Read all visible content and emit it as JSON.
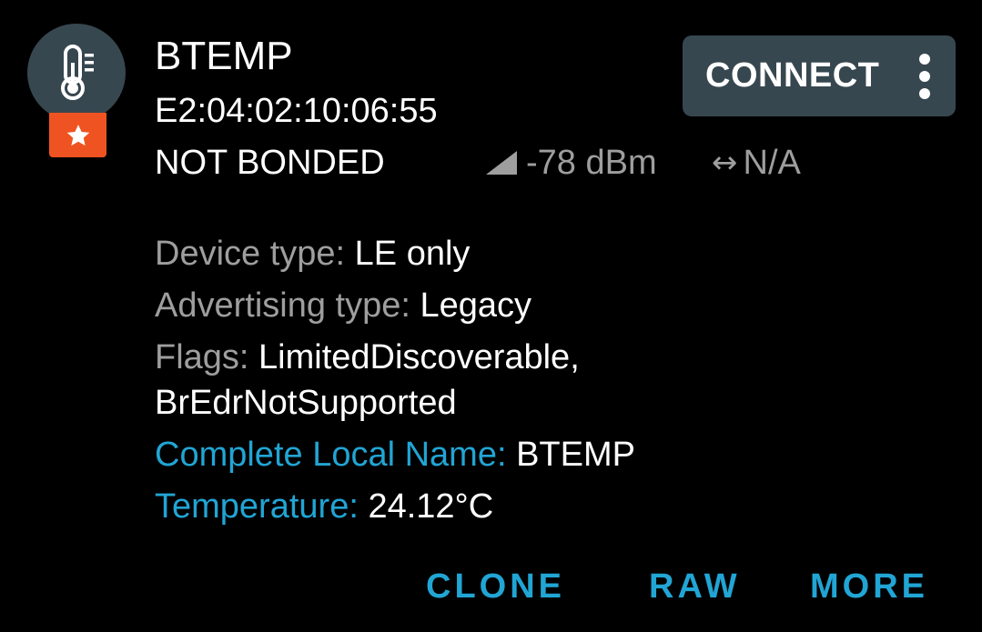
{
  "device": {
    "name": "BTEMP",
    "address": "E2:04:02:10:06:55",
    "bond_state": "NOT BONDED",
    "rssi": "-78 dBm",
    "interval": "N/A",
    "avatar_icon": "thermometer-icon",
    "favorite_icon": "star-icon"
  },
  "connect_button": {
    "label": "CONNECT",
    "overflow_icon": "more-vert-icon"
  },
  "details": {
    "device_type": {
      "label": "Device type: ",
      "value": "LE only"
    },
    "advertising_type": {
      "label": "Advertising type: ",
      "value": "Legacy"
    },
    "flags": {
      "label": "Flags: ",
      "value_line1": "LimitedDiscoverable,",
      "value_line2": "BrEdrNotSupported"
    },
    "complete_local_name": {
      "label": "Complete Local Name: ",
      "value": "BTEMP"
    },
    "temperature": {
      "label": "Temperature: ",
      "value": "24.12°C"
    }
  },
  "actions": {
    "clone": "CLONE",
    "raw": "RAW",
    "more": "MORE"
  },
  "colors": {
    "background": "#000000",
    "avatar_bg": "#37474f",
    "favorite_badge": "#f05322",
    "accent_blue": "#21a5d4",
    "label_grey": "#9e9e9e",
    "text_white": "#ffffff"
  }
}
